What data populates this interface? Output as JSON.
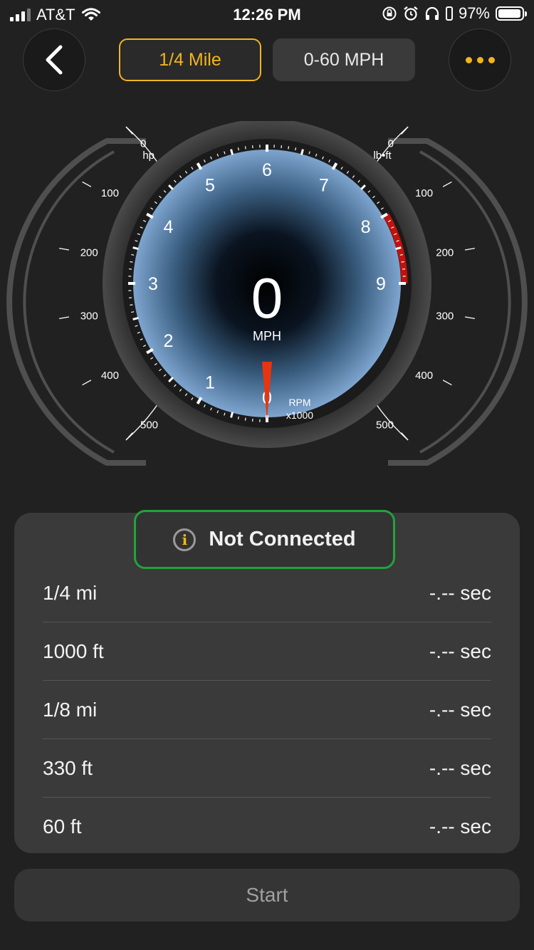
{
  "status": {
    "carrier": "AT&T",
    "time": "12:26 PM",
    "battery": "97%"
  },
  "nav": {
    "tabs": [
      {
        "label": "1/4 Mile",
        "active": true
      },
      {
        "label": "0-60 MPH",
        "active": false
      }
    ]
  },
  "gauge": {
    "speed": "0",
    "speed_unit": "MPH",
    "rpm_label": "RPM",
    "rpm_multiplier": "x1000",
    "rpm_value": 0,
    "rpm_ticks": [
      "0",
      "1",
      "2",
      "3",
      "4",
      "5",
      "6",
      "7",
      "8",
      "9"
    ],
    "hp_scale": [
      "0",
      "100",
      "200",
      "300",
      "400",
      "500"
    ],
    "hp_unit": "hp",
    "torque_scale": [
      "0",
      "100",
      "200",
      "300",
      "400",
      "500"
    ],
    "torque_unit": "lb•ft",
    "hp_value": 0,
    "torque_value": 0
  },
  "connection": {
    "status": "Not Connected",
    "icon": "info-icon"
  },
  "results": [
    {
      "distance": "1/4 mi",
      "time": "-.-- sec"
    },
    {
      "distance": "1000 ft",
      "time": "-.-- sec"
    },
    {
      "distance": "1/8 mi",
      "time": "-.-- sec"
    },
    {
      "distance": "330 ft",
      "time": "-.-- sec"
    },
    {
      "distance": "60 ft",
      "time": "-.-- sec"
    }
  ],
  "start_label": "Start",
  "colors": {
    "accent": "#f2b51c",
    "connected_border": "#21a33a",
    "redline": "#c1120e",
    "needle": "#e83510"
  }
}
